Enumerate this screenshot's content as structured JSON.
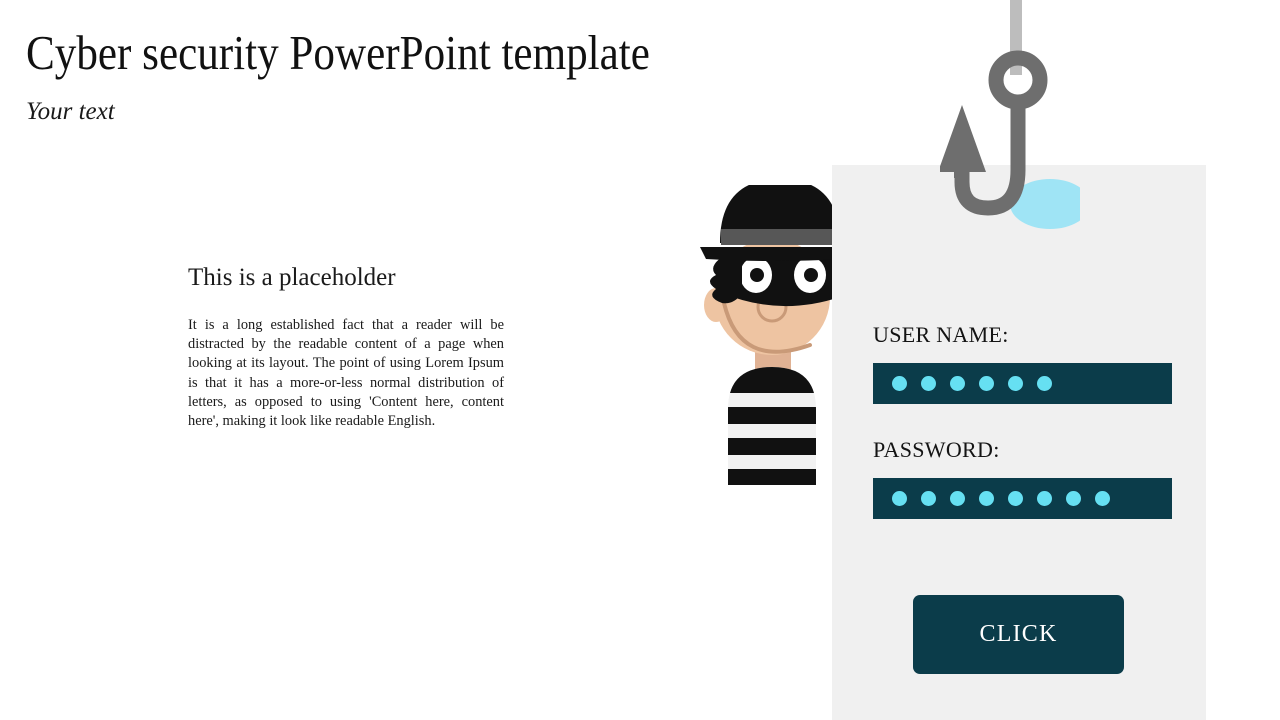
{
  "slide": {
    "title": "Cyber security PowerPoint template",
    "subtitle": "Your text",
    "background_color": "#ffffff"
  },
  "content_block": {
    "heading": "This is a placeholder",
    "paragraph": "It is a long established fact that a reader will be distracted by the readable content of a page when looking at its layout. The point of using Lorem Ipsum is that it has a more-or-less normal distribution of letters, as opposed to using 'Content here, content here', making it look like readable English."
  },
  "login_panel": {
    "background_color": "#f0f0f0",
    "field_color": "#0b3c4a",
    "dot_color": "#66e0f2",
    "username_label": "USER NAME:",
    "username_dot_count": 6,
    "password_label": "PASSWORD:",
    "password_dot_count": 8,
    "button_label": "CLICK"
  },
  "illustration": {
    "thief_name": "thief-character",
    "hat_color": "#111111",
    "hat_band_color": "#575757",
    "skin_color": "#eec4a2",
    "mask_color": "#111111",
    "stripe_dark": "#111111",
    "stripe_light": "#f2f2f2"
  },
  "hook": {
    "name": "fishing-hook",
    "line_color": "#bdbdbd",
    "metal_color": "#6e6e6e",
    "water_color": "#9fe4f5"
  }
}
